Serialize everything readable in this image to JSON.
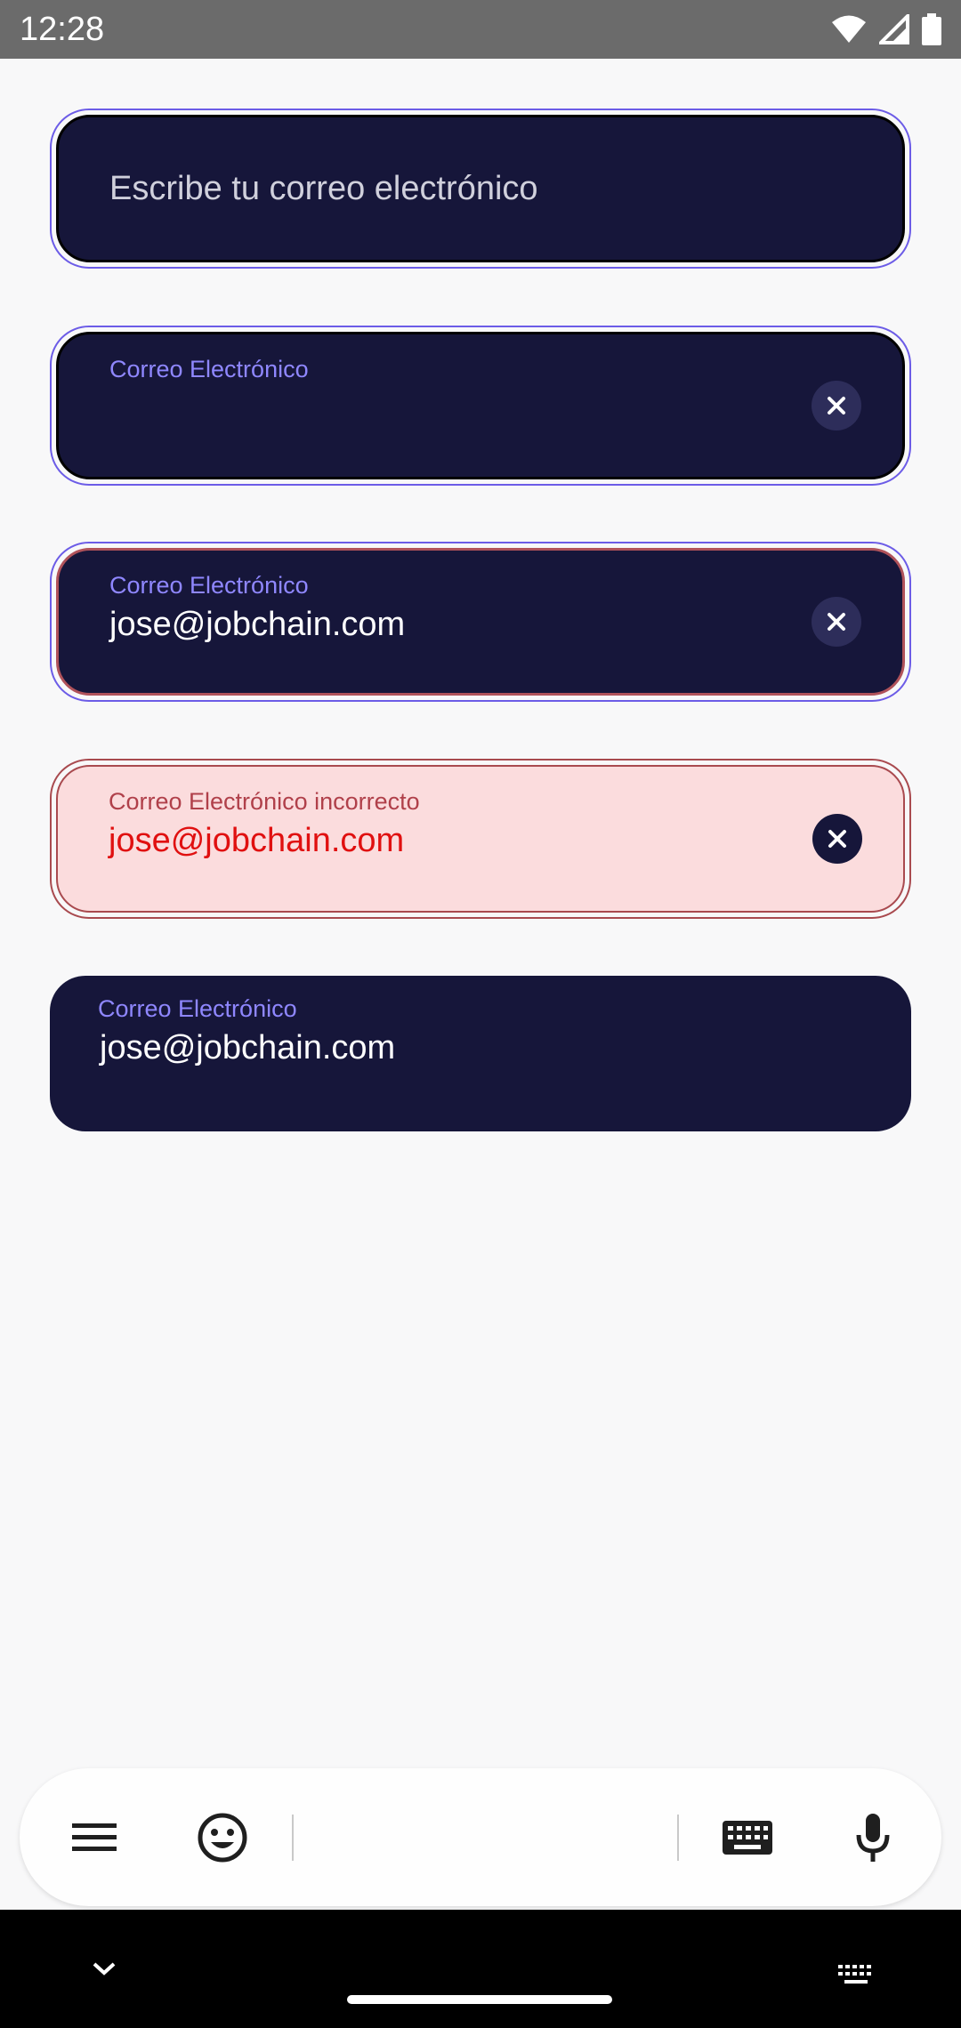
{
  "status_bar": {
    "time": "12:28",
    "icons": [
      "wifi-icon",
      "signal-icon",
      "battery-icon"
    ]
  },
  "fields": {
    "empty": {
      "placeholder": "Escribe tu correo electrónico"
    },
    "focused_empty": {
      "label": "Correo Electrónico",
      "value": ""
    },
    "focused_filled": {
      "label": "Correo Electrónico",
      "value": "jose@jobchain.com"
    },
    "error": {
      "label": "Correo Electrónico incorrecto",
      "value": "jose@jobchain.com"
    },
    "filled": {
      "label": "Correo Electrónico",
      "value": "jose@jobchain.com"
    }
  },
  "keyboard_toolbar": {
    "icons": [
      "menu-icon",
      "emoji-icon",
      "keyboard-icon",
      "microphone-icon"
    ]
  },
  "nav_bar": {
    "icons": [
      "chevron-down-icon",
      "keyboard-switch-icon"
    ]
  },
  "colors": {
    "field_bg": "#16163a",
    "accent": "#6c5ce7",
    "label": "#8f87ff",
    "error_text": "#e01010",
    "error_bg": "#fbdcdd"
  }
}
